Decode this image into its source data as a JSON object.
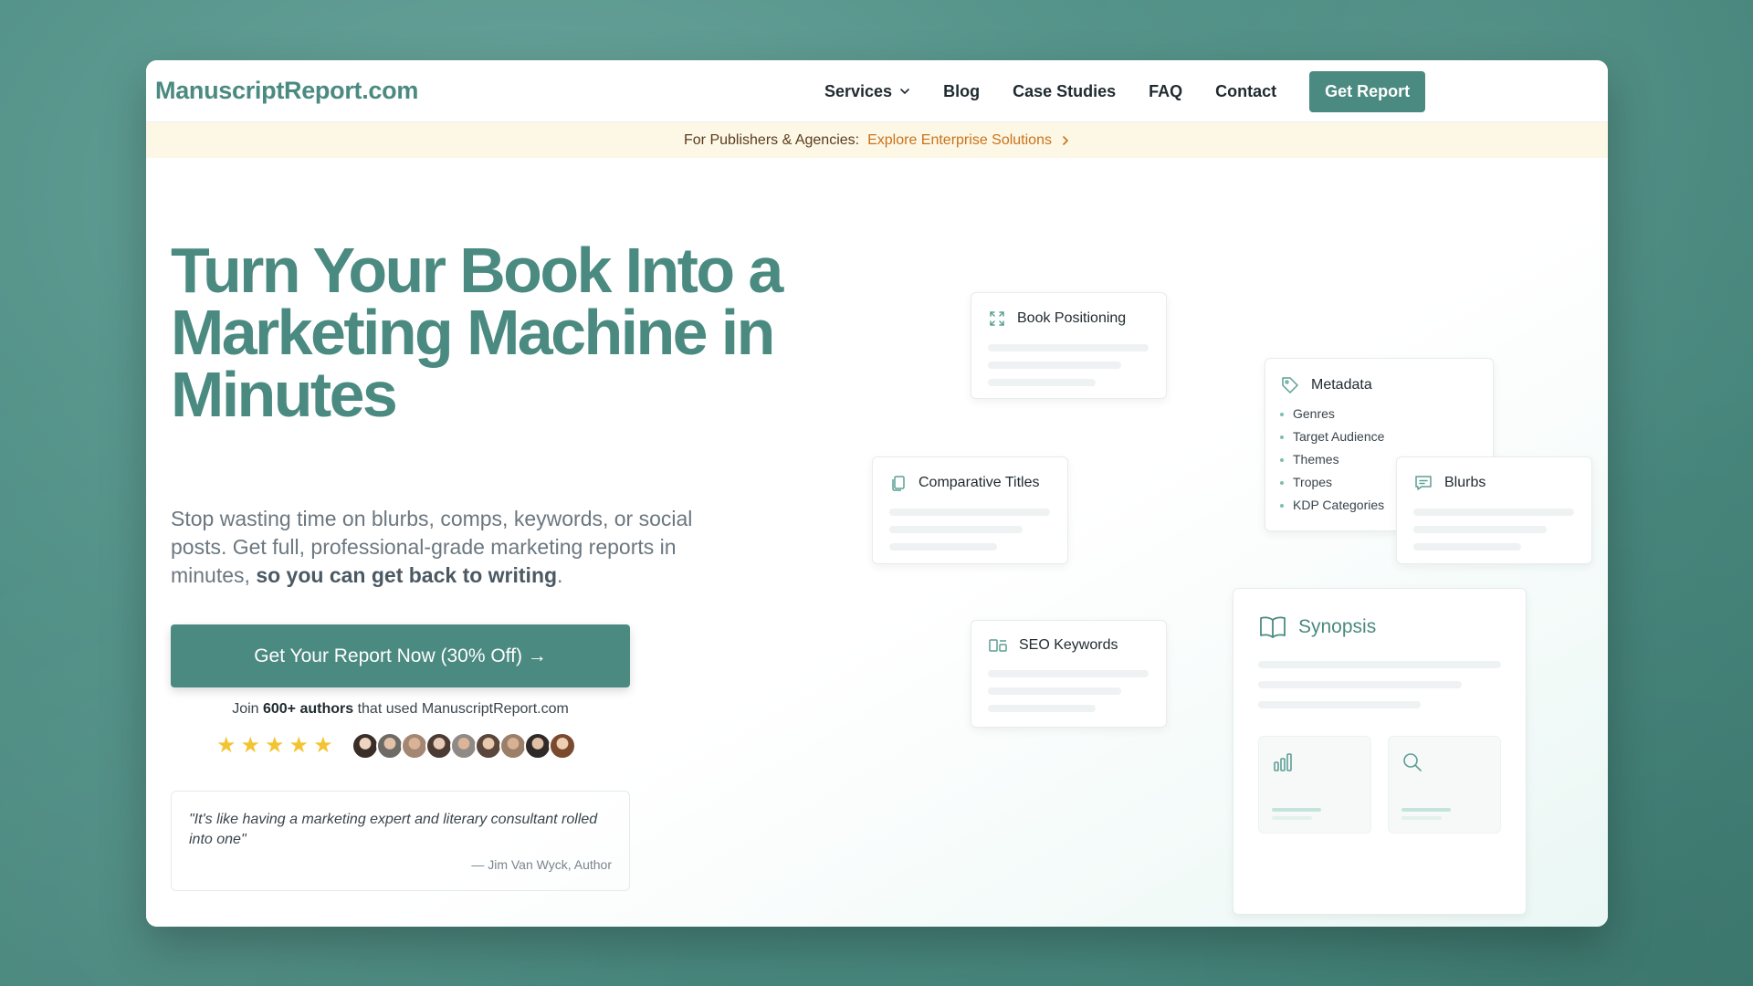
{
  "nav": {
    "logo": "ManuscriptReport.com",
    "links": [
      "Services",
      "Blog",
      "Case Studies",
      "FAQ",
      "Contact"
    ],
    "cta": "Get Report"
  },
  "banner": {
    "prefix": "For Publishers & Agencies:",
    "link": "Explore Enterprise Solutions"
  },
  "hero": {
    "headline": "Turn Your Book Into a Marketing Machine in Minutes",
    "subtext_plain": "Stop wasting time on blurbs, comps, keywords, or social posts. Get full, professional-grade marketing reports in minutes, ",
    "subtext_bold": "so you can get back to writing",
    "subtext_end": ".",
    "cta": "Get Your Report Now (30% Off) →",
    "join_prefix": "Join ",
    "join_bold": "600+ authors",
    "join_suffix": " that used ManuscriptReport.com",
    "rating_stars": 5,
    "avatar_count": 9,
    "testimonial": {
      "quote": "\"It's like having a marketing expert and literary consultant rolled into one\"",
      "author": "— Jim Van Wyck, Author"
    }
  },
  "cards": {
    "book_positioning": "Book Positioning",
    "metadata": {
      "title": "Metadata",
      "items": [
        "Genres",
        "Target Audience",
        "Themes",
        "Tropes",
        "KDP Categories"
      ]
    },
    "comparative_titles": "Comparative Titles",
    "blurbs": "Blurbs",
    "seo_keywords": "SEO Keywords",
    "synopsis": "Synopsis"
  },
  "colors": {
    "brand": "#4a8a80",
    "banner_bg": "#fdf7e6",
    "banner_link": "#c9731a",
    "star": "#f3c432"
  },
  "icons": {
    "services_dropdown": "chevron-down-icon",
    "banner_link": "chevron-right-icon",
    "book_positioning": "expand-icon",
    "metadata": "tag-icon",
    "comparative_titles": "copy-icon",
    "blurbs": "message-icon",
    "seo_keywords": "layout-icon",
    "synopsis": "open-book-icon",
    "synopsis_tile_1": "bar-chart-icon",
    "synopsis_tile_2": "search-icon"
  }
}
